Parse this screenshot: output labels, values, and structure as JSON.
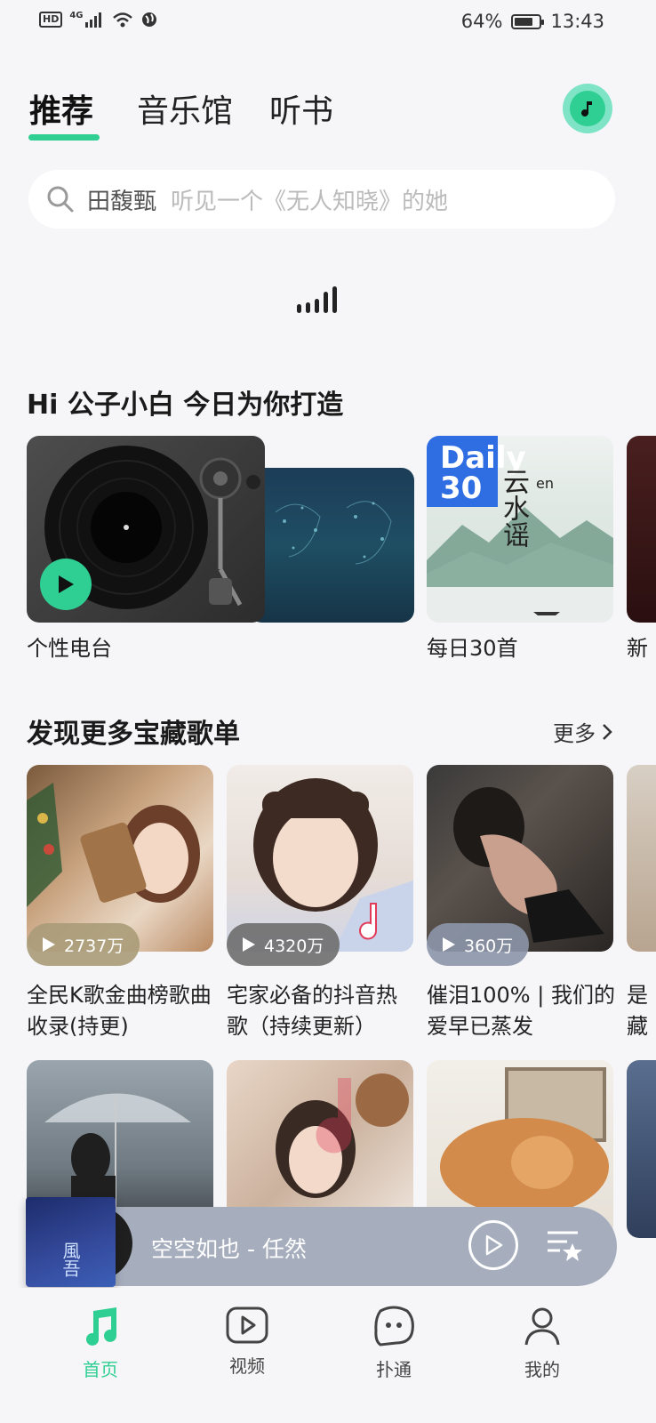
{
  "status_bar": {
    "net_hd": "HD",
    "net_gen": "4G",
    "battery": "64%",
    "time": "13:43"
  },
  "tabs": [
    {
      "label": "推荐",
      "active": true
    },
    {
      "label": "音乐馆",
      "active": false
    },
    {
      "label": "听书",
      "active": false
    }
  ],
  "search": {
    "keyword": "田馥甄",
    "placeholder": "听见一个《无人知晓》的她"
  },
  "daily": {
    "greeting": "Hi 公子小白  今日为你打造",
    "items": [
      {
        "label": "个性电台"
      },
      {
        "label": "每日30首",
        "badge_line1": "Daily",
        "badge_line2": "30",
        "art_text": "云水谣",
        "art_suffix": "en"
      },
      {
        "label": "新"
      }
    ]
  },
  "discover": {
    "title": "发现更多宝藏歌单",
    "more": "更多",
    "playlists": [
      {
        "plays": "2737万",
        "title": "全民K歌金曲榜歌曲收录(持更)"
      },
      {
        "plays": "4320万",
        "title": "宅家必备的抖音热歌（持续更新）"
      },
      {
        "plays": "360万",
        "title": "催泪100% | 我们的爱早已蒸发"
      },
      {
        "title": "是藏"
      }
    ]
  },
  "mini_player": {
    "title": "空空如也 - 任然",
    "cover_text": "風吾"
  },
  "bottom_nav": [
    {
      "label": "首页",
      "icon": "music-note-icon",
      "active": true
    },
    {
      "label": "视频",
      "icon": "video-play-icon",
      "active": false
    },
    {
      "label": "扑通",
      "icon": "chat-bubble-icon",
      "active": false
    },
    {
      "label": "我的",
      "icon": "person-icon",
      "active": false
    }
  ],
  "colors": {
    "accent": "#2fcf93",
    "background": "#f6f6f8",
    "mini_player": "#a6aebe"
  }
}
